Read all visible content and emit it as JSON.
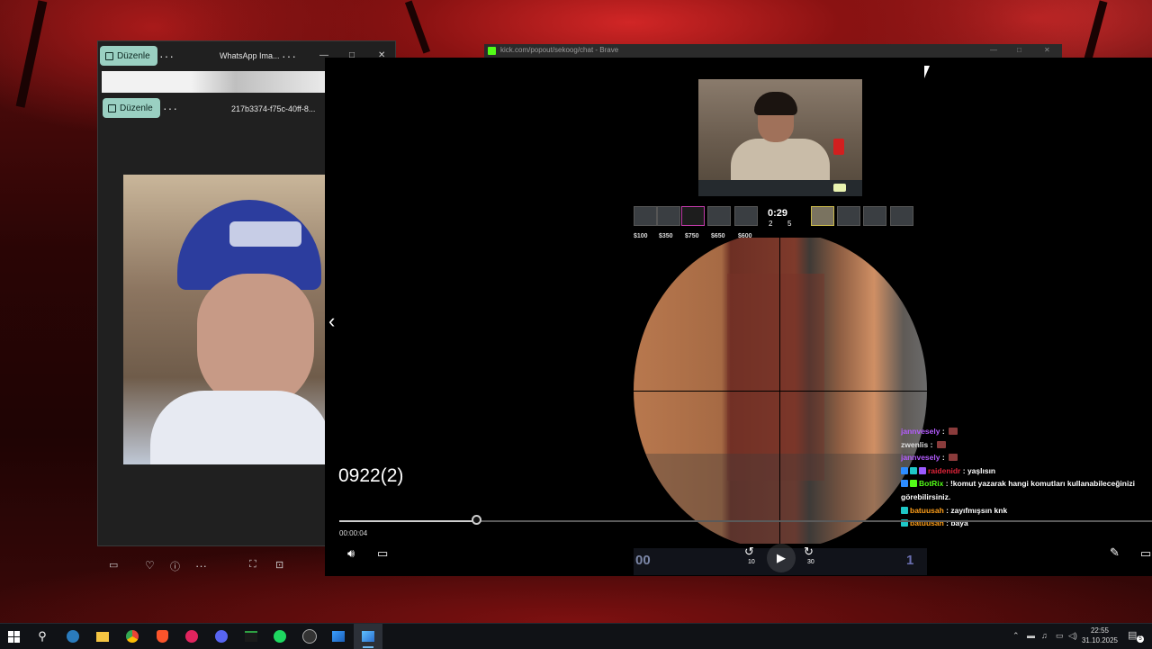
{
  "photos_window": {
    "edit_label": "Düzenle",
    "more_label": "···",
    "title": "WhatsApp Ima...",
    "title_more_label": "···",
    "min_label": "—",
    "max_label": "□",
    "close_label": "✕",
    "edit_label_2": "Düzenle",
    "more_label_2": "···",
    "file_name": "217b3374-f75c-40ff-8...",
    "bottom_more_label": "···"
  },
  "brave_window": {
    "url": "kick.com/popout/sekoog/chat - Brave",
    "min_label": "—",
    "max_label": "□",
    "close_label": "✕"
  },
  "video": {
    "title": "0922(2)",
    "elapsed": "00:00:04",
    "progress": 0.168,
    "skip_back_label": "10",
    "skip_forward_label": "30"
  },
  "game_hud": {
    "round_timer": "0:29",
    "score_left": "2",
    "score_right": "5",
    "money": [
      "$100",
      "$350",
      "$750",
      "$650",
      "$600"
    ],
    "scoreboard_left": "00",
    "scoreboard_right": "1"
  },
  "chat": [
    {
      "user": "jannvesely",
      "message": "",
      "color": "#b45cff",
      "emote": true
    },
    {
      "user": "zwenlis",
      "message": "",
      "color": "#dddddd",
      "emote": true
    },
    {
      "user": "jannvesely",
      "message": "",
      "color": "#b45cff",
      "emote": true
    },
    {
      "user": "raidenidr",
      "message": "yaşlısın",
      "color": "#e0243a",
      "badges": [
        "#2d8cff",
        "#1ec8c8",
        "#9b59ff"
      ]
    },
    {
      "user": "BotRix",
      "message": "!komut yazarak hangi komutları kullanabileceğinizi görebilirsiniz.",
      "color": "#53fc18",
      "badges": [
        "#2d8cff",
        "#53fc18"
      ]
    },
    {
      "user": "batuusah",
      "message": "zayıfmışsın knk",
      "color": "#ff9f1a",
      "badges": [
        "#1ec8c8"
      ]
    },
    {
      "user": "batuusah",
      "message": "baya",
      "color": "#ff9f1a",
      "badges": [
        "#1ec8c8"
      ]
    }
  ],
  "taskbar": {
    "time": "22:55",
    "date": "31.10.2025",
    "notification_count": "5",
    "active_app": "photos-icon"
  }
}
